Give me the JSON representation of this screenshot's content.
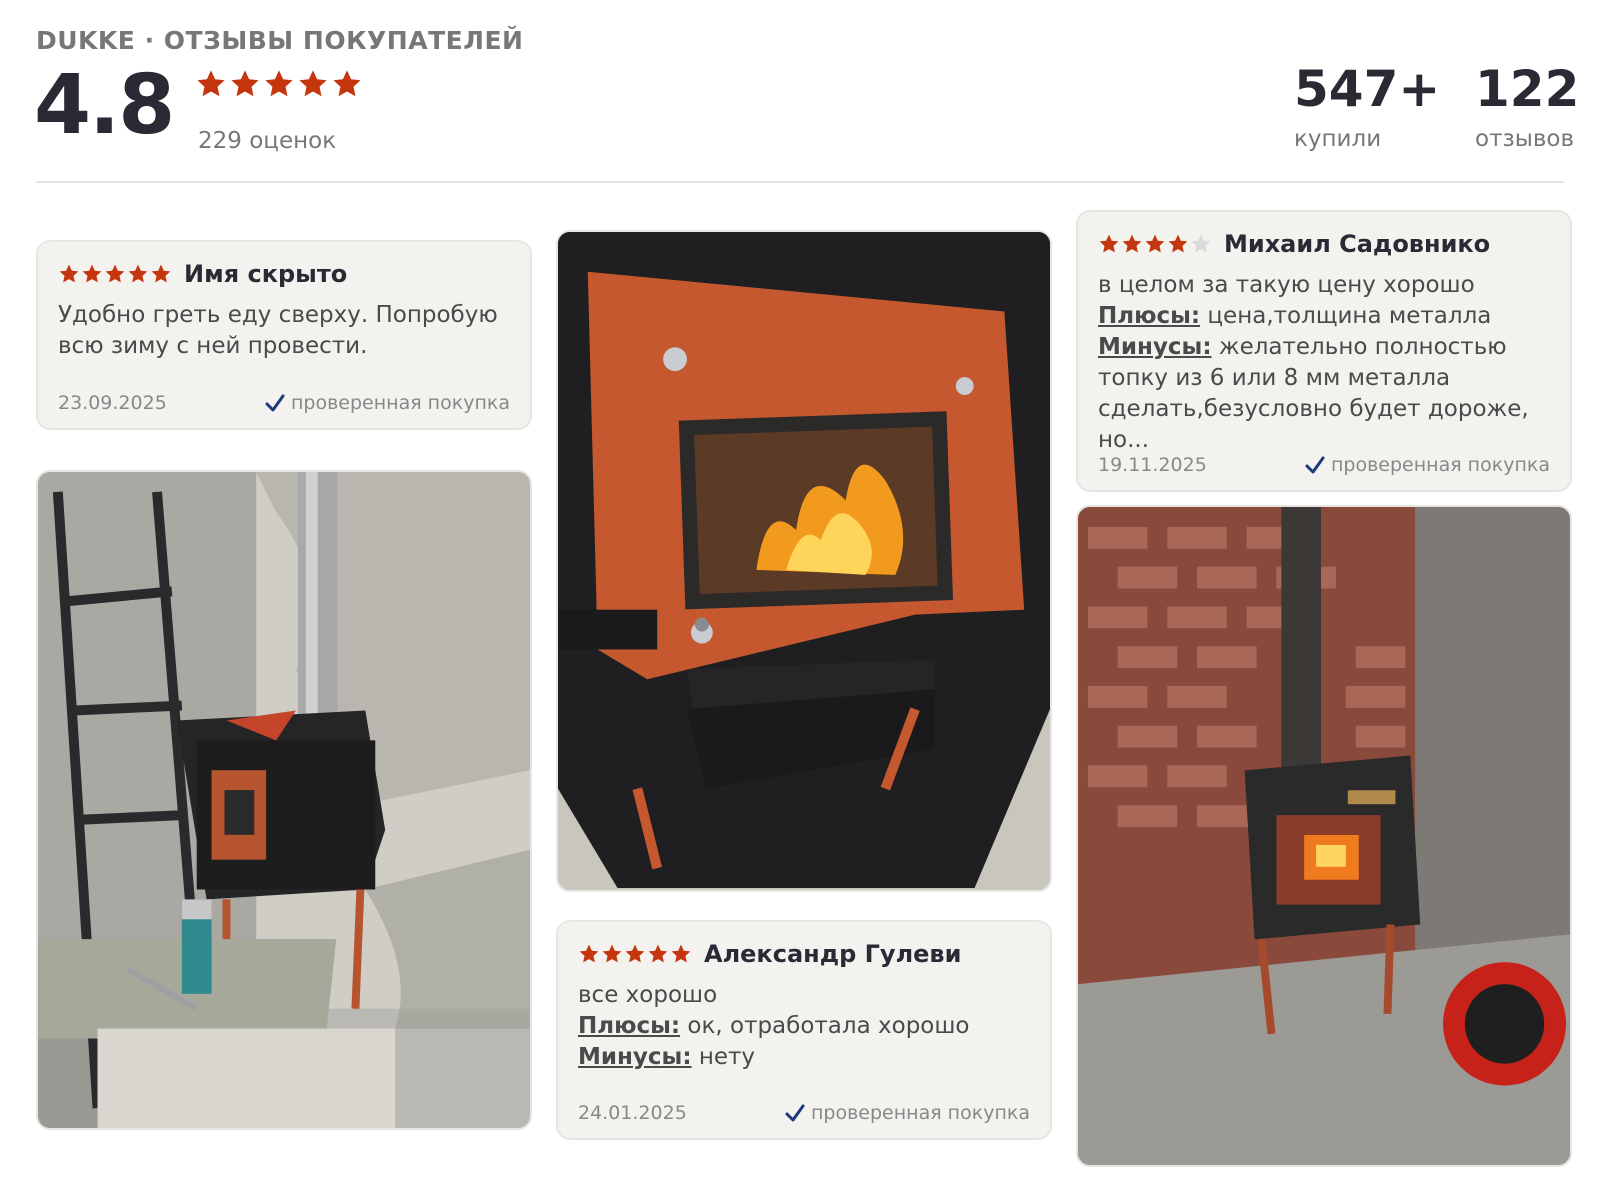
{
  "header": {
    "brand_title": "DUKKE · ОТЗЫВЫ ПОКУПАТЕЛЕЙ",
    "rating": "4.8",
    "stars": 5,
    "ratings_count": "229 оценок",
    "bought_value": "547+",
    "bought_label": "купили",
    "reviews_value": "122",
    "reviews_label": "отзывов"
  },
  "colors": {
    "star": "#c5360f",
    "star_empty": "#d9d9d9",
    "verified_check": "#1f3a7a",
    "card_bg": "#f3f2ef",
    "stove_orange": "#c55a35"
  },
  "reviews": [
    {
      "stars": 5,
      "author": "Имя скрыто",
      "text": "Удобно греть еду сверху. Попробую всю зиму с ней провести.",
      "date": "23.09.2025",
      "verified": "проверенная покупка"
    },
    {
      "stars": 4,
      "author": "Михаил Садовнико",
      "text_intro": "в целом за такую цену хорошо",
      "pros_label": "Плюсы:",
      "pros": "цена,толщина металла",
      "cons_label": "Минусы:",
      "cons": "желательно полностью топку из 6 или 8 мм металла сделать,безусловно будет дороже, но...",
      "date": "19.11.2025",
      "verified": "проверенная покупка"
    },
    {
      "stars": 5,
      "author": "Александр Гулеви",
      "text_intro": "все хорошо",
      "pros_label": "Плюсы:",
      "pros": "ок, отработала хорошо",
      "cons_label": "Минусы:",
      "cons": "нету",
      "date": "24.01.2025",
      "verified": "проверенная покупка"
    }
  ],
  "photos": [
    {
      "icon": "stove-in-corner-photo"
    },
    {
      "icon": "stove-firebox-closeup-photo"
    },
    {
      "icon": "stove-brick-wall-photo"
    }
  ]
}
